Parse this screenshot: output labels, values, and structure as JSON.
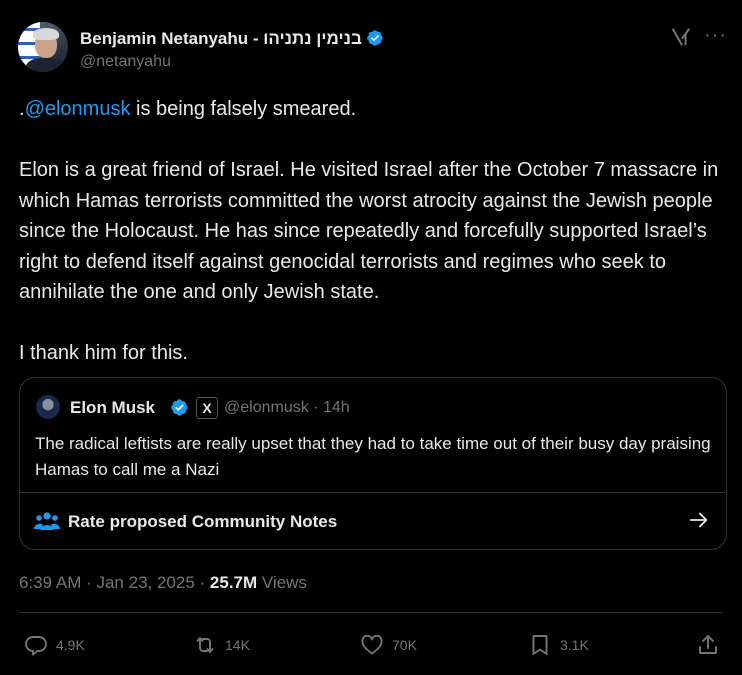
{
  "author": {
    "name": "Benjamin Netanyahu - בנימין נתניהו",
    "handle": "@netanyahu"
  },
  "tweet": {
    "mention": "@elonmusk",
    "line1_prefix": ".",
    "line1_suffix": " is being falsely smeared.",
    "paragraph2": "Elon is a great friend of Israel.  He visited Israel after the October 7 massacre in which Hamas terrorists committed the worst atrocity against the Jewish people since the Holocaust. He has since repeatedly and forcefully supported Israel’s right to defend itself against genocidal terrorists and regimes who seek to annihilate the one and only Jewish state.",
    "paragraph3": "I thank him for this."
  },
  "quote": {
    "name": "Elon Musk",
    "badge": "X",
    "handle_time": "@elonmusk · 14h",
    "text": "The radical leftists are really upset that they had to take time out of their busy day praising Hamas to call me a Nazi",
    "community_notes_label": "Rate proposed Community Notes"
  },
  "meta": {
    "timestamp": "6:39 AM · Jan 23, 2025 · ",
    "views_count": "25.7M",
    "views_label": " Views"
  },
  "actions": {
    "replies": "4.9K",
    "reposts": "14K",
    "likes": "70K",
    "bookmarks": "3.1K"
  },
  "colors": {
    "background": "#000000",
    "text": "#e7e9ea",
    "secondary": "#71767b",
    "link": "#1d9bf0",
    "verified": "#1d9bf0",
    "border": "#2f3336"
  },
  "icons": [
    "verified-badge-icon",
    "grok-icon",
    "more-icon",
    "community-notes-icon",
    "arrow-right-icon",
    "reply-icon",
    "repost-icon",
    "like-icon",
    "bookmark-icon",
    "share-icon"
  ]
}
